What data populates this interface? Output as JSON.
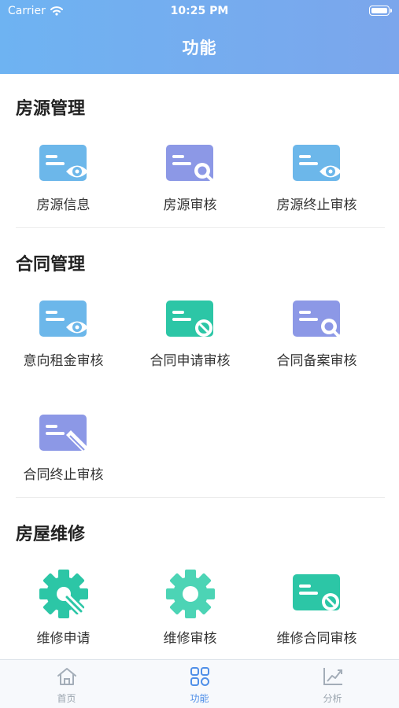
{
  "status_bar": {
    "carrier": "Carrier",
    "time": "10:25 PM"
  },
  "nav": {
    "title": "功能"
  },
  "sections": [
    {
      "title": "房源管理",
      "items": [
        {
          "label": "房源信息",
          "icon": "card-eye-icon"
        },
        {
          "label": "房源审核",
          "icon": "card-search-icon"
        },
        {
          "label": "房源终止审核",
          "icon": "card-eye-icon"
        }
      ]
    },
    {
      "title": "合同管理",
      "items": [
        {
          "label": "意向租金审核",
          "icon": "card-eye-icon"
        },
        {
          "label": "合同申请审核",
          "icon": "card-block-icon"
        },
        {
          "label": "合同备案审核",
          "icon": "card-search-icon"
        },
        {
          "label": "合同终止审核",
          "icon": "card-pen-icon"
        }
      ]
    },
    {
      "title": "房屋维修",
      "items": [
        {
          "label": "维修申请",
          "icon": "gear-wrench-icon"
        },
        {
          "label": "维修审核",
          "icon": "gear-icon"
        },
        {
          "label": "维修合同审核",
          "icon": "card-block-icon"
        }
      ]
    }
  ],
  "tabbar": {
    "items": [
      {
        "label": "首页",
        "icon": "home-icon",
        "active": false
      },
      {
        "label": "功能",
        "icon": "grid-icon",
        "active": true
      },
      {
        "label": "分析",
        "icon": "chart-icon",
        "active": false
      }
    ]
  },
  "colors": {
    "header_start": "#6eb3f2",
    "header_end": "#7ba6ec",
    "card_blue": "#6cb7ea",
    "card_purple": "#8c98e6",
    "card_teal": "#2cc6a6",
    "tab_active": "#4f8fe8",
    "tab_inactive": "#9aa4ae"
  }
}
